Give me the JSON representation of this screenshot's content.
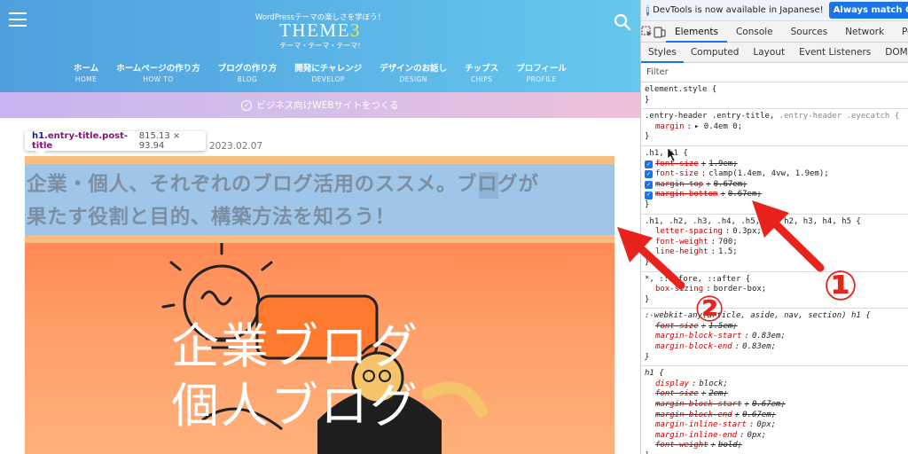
{
  "site": {
    "tagline": "WordPressテーマの楽しさを学ぼう！",
    "logo_main": "THEME",
    "logo_accent": "3",
    "logo_sub": "テーマ・テーマ・テーマ!",
    "nav": [
      {
        "label": "ホーム",
        "sub": "HOME"
      },
      {
        "label": "ホームページの作り方",
        "sub": "HOW TO"
      },
      {
        "label": "ブログの作り方",
        "sub": "BLOG"
      },
      {
        "label": "開発にチャレンジ",
        "sub": "DEVELOP"
      },
      {
        "label": "デザインのお話し",
        "sub": "DESIGN"
      },
      {
        "label": "チップス",
        "sub": "CHIPS"
      },
      {
        "label": "プロフィール",
        "sub": "PROFILE"
      }
    ],
    "promo": "ビジネス向けWEBサイトをつくる"
  },
  "inspect_tooltip": {
    "tag": "h1",
    "classes": ".entry-title.post-title",
    "size": "815.13 × 93.94"
  },
  "post": {
    "date": "2023.02.07",
    "title_line1": "企業・個人、それぞれのブログ活用のススメ。ブログが",
    "title_line2": "果たす役割と目的、構築方法を知ろう！",
    "eyecatch_line1": "企業ブログ",
    "eyecatch_line2": "個人ブログ"
  },
  "annotations": {
    "marker1": "①",
    "marker2": "②",
    "color": "#e8231c"
  },
  "devtools": {
    "banner_msg": "DevTools is now available in Japanese!",
    "banner_btn": "Always match Chrome",
    "tabs": [
      "Elements",
      "Console",
      "Sources",
      "Network",
      "Pe"
    ],
    "subtabs": [
      "Styles",
      "Computed",
      "Layout",
      "Event Listeners",
      "DOM Breakpo"
    ],
    "filter_placeholder": "Filter",
    "rules": {
      "r1_sel": "element.style {",
      "r2_sel_a": ".entry-header .entry-title, ",
      "r2_sel_b": ".entry-header .eyecatch {",
      "r2_prop": "margin",
      "r2_val": "▸ 0.4em 0;",
      "r3_sel": ".h1, h1 {",
      "r3_d1_prop": "font-size",
      "r3_d1_val": "1.9em;",
      "r3_d2_prop": "font-size",
      "r3_d2_val": "clamp(1.4em, 4vw, 1.9em);",
      "r3_d3_prop": "margin-top",
      "r3_d3_val": "0.67em;",
      "r3_d4_prop": "margin-bottom",
      "r3_d4_val": "0.67em;",
      "r4_sel": ".h1, .h2, .h3, .h4, .h5, h1, h2, h3, h4, h5 {",
      "r4_d1_prop": "letter-spacing",
      "r4_d1_val": "0.3px;",
      "r4_d2_prop": "font-weight",
      "r4_d2_val": "700;",
      "r4_d3_prop": "line-height",
      "r4_d3_val": "1.5;",
      "r5_sel": "*, ::before, ::after {",
      "r5_prop": "box-sizing",
      "r5_val": "border-box;",
      "r6_sel": ":-webkit-any(article, aside, nav, section) h1 {",
      "r6_d1_prop": "font-size",
      "r6_d1_val": "1.5em;",
      "r6_d2_prop": "margin-block-start",
      "r6_d2_val": "0.83em;",
      "r6_d3_prop": "margin-block-end",
      "r6_d3_val": "0.83em;",
      "r7_sel": "h1 {",
      "r7_d1_prop": "display",
      "r7_d1_val": "block;",
      "r7_d2_prop": "font-size",
      "r7_d2_val": "2em;",
      "r7_d3_prop": "margin-block-start",
      "r7_d3_val": "0.67em;",
      "r7_d4_prop": "margin-block-end",
      "r7_d4_val": "0.67em;",
      "r7_d5_prop": "margin-inline-start",
      "r7_d5_val": "0px;",
      "r7_d6_prop": "margin-inline-end",
      "r7_d6_val": "0px;",
      "r7_d7_prop": "font-weight",
      "r7_d7_val": "bold;",
      "close": "}"
    }
  }
}
